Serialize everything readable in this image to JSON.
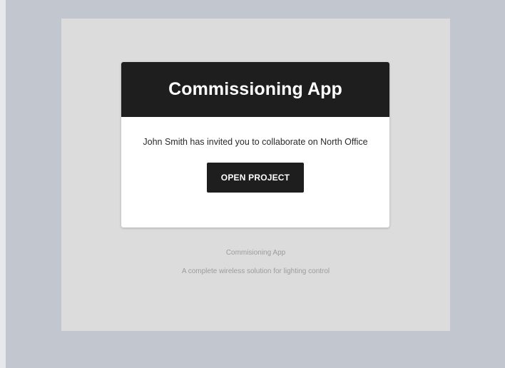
{
  "email": {
    "header_title": "Commissioning App",
    "invite_text": "John Smith has invited you to collaborate on North Office",
    "button_label": "OPEN PROJECT",
    "footer_app_name": "Commisioning App",
    "footer_tagline": "A complete wireless solution for lighting control"
  },
  "colors": {
    "page_background": "#c2c7cf",
    "frame_background": "#dcdcdc",
    "header_background": "#1e1e1e",
    "button_background": "#1e1e1e",
    "card_background": "#ffffff"
  }
}
